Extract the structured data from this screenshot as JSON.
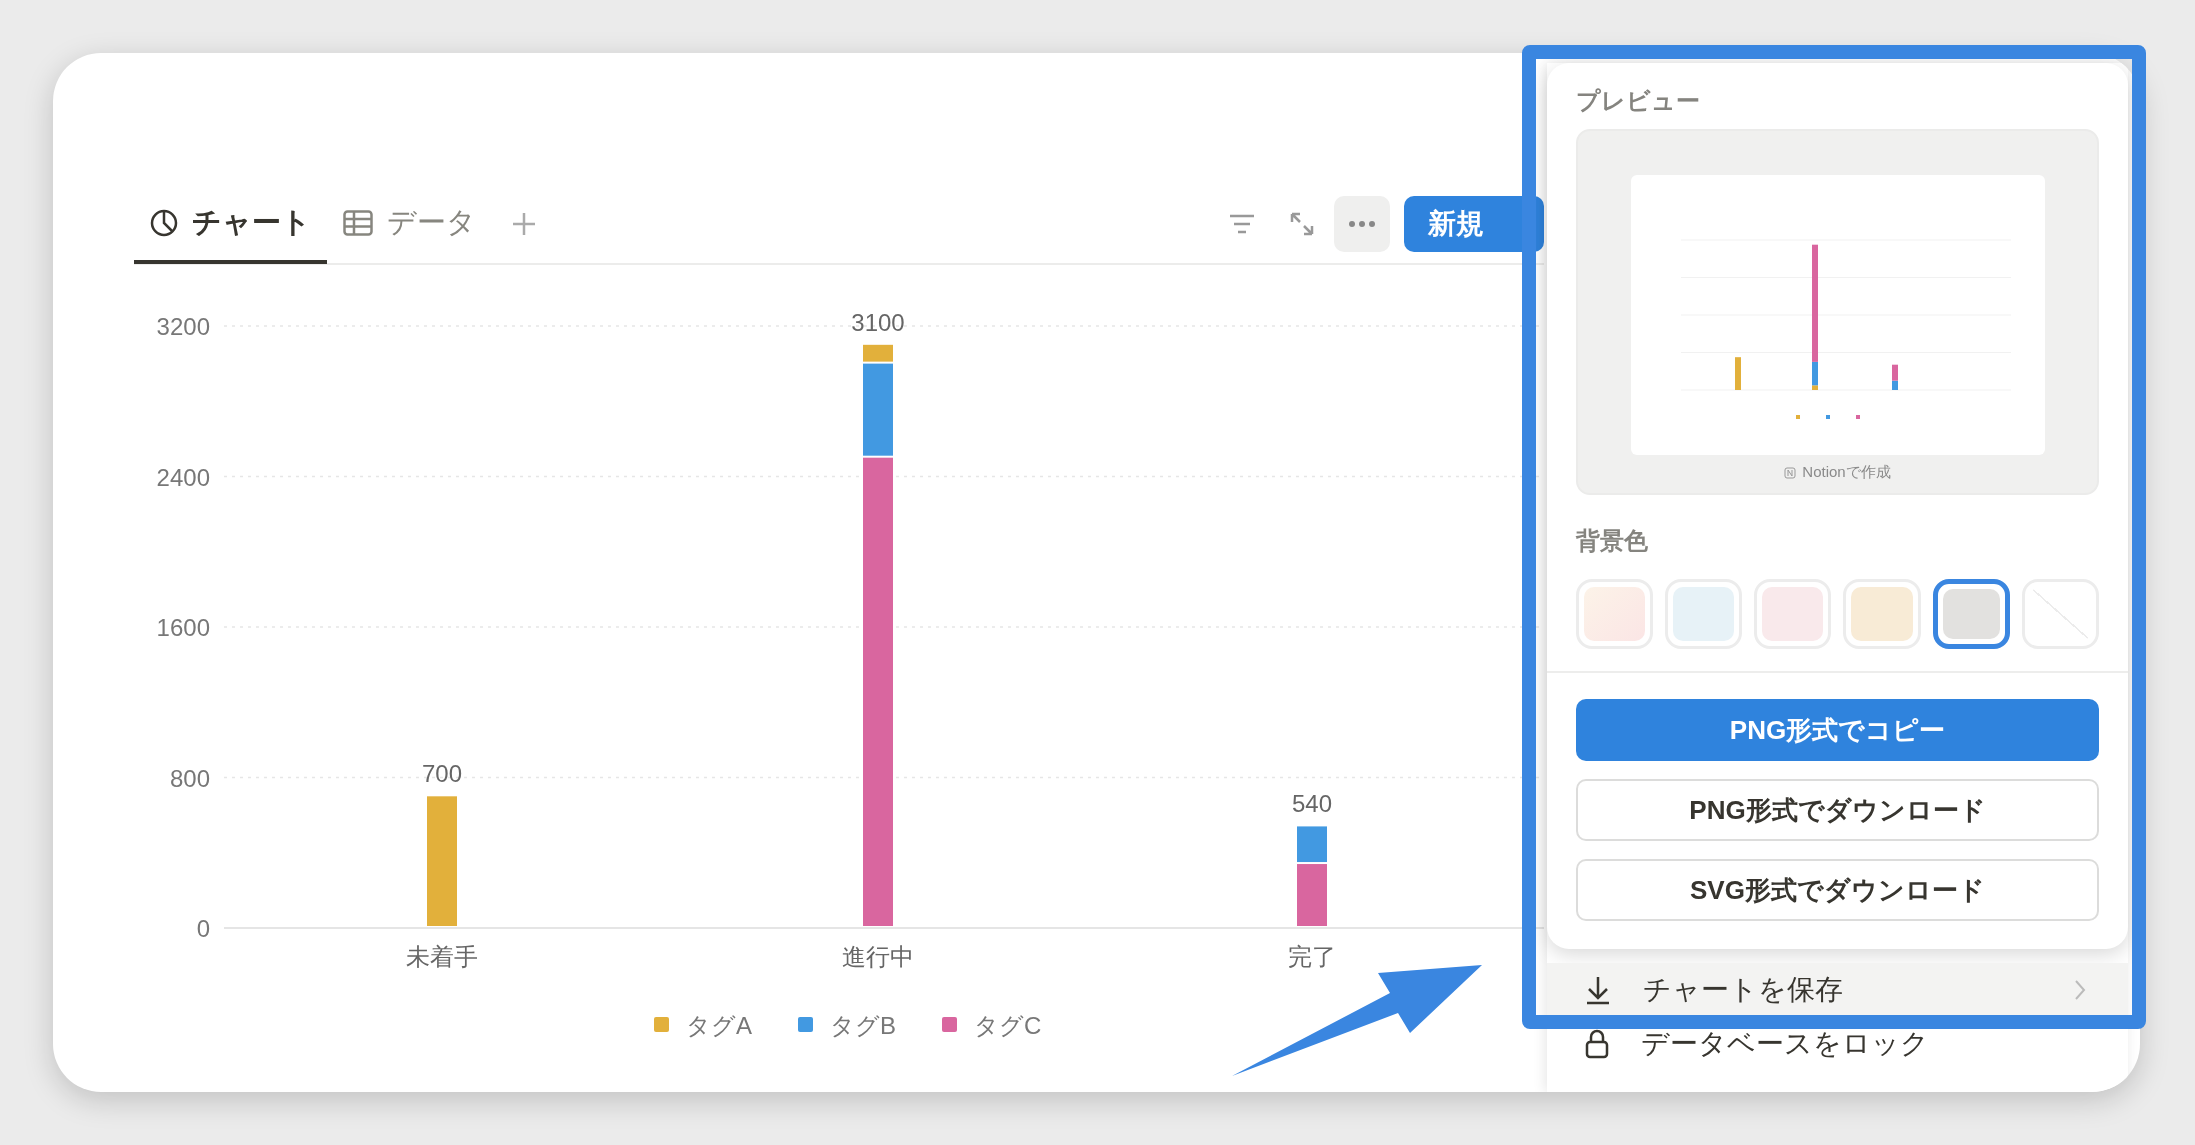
{
  "tabs": [
    {
      "label": "チャート",
      "selected": true
    },
    {
      "label": "データ",
      "selected": false
    }
  ],
  "toolbar": {
    "new_button": "新規"
  },
  "chart": {
    "chart_data": {
      "type": "bar",
      "stacked": true,
      "categories": [
        "未着手",
        "進行中",
        "完了"
      ],
      "series": [
        {
          "name": "タグA",
          "color": "#e2b03b",
          "values": [
            700,
            100,
            null
          ]
        },
        {
          "name": "タグB",
          "color": "#4299e1",
          "values": [
            null,
            500,
            200
          ]
        },
        {
          "name": "タグC",
          "color": "#d9669f",
          "values": [
            null,
            2500,
            340
          ]
        }
      ],
      "ylim": [
        0,
        3200
      ],
      "grid": true,
      "legend": true,
      "yticks": [
        0,
        800,
        1600,
        2400,
        3200
      ],
      "value_labels": [
        "700",
        "3100",
        "540"
      ]
    }
  },
  "panel": {
    "preview_label": "プレビュー",
    "preview_footer": "Notionで作成",
    "background_label": "背景色",
    "swatches": [
      {
        "kind": "gradient",
        "color": "#fcf3e8",
        "selected": false
      },
      {
        "kind": "solid",
        "color": "#e7f2f7",
        "selected": false
      },
      {
        "kind": "solid",
        "color": "#f9e9eb",
        "selected": false
      },
      {
        "kind": "solid",
        "color": "#f8ebd6",
        "selected": false
      },
      {
        "kind": "solid",
        "color": "#e2e1df",
        "selected": true
      },
      {
        "kind": "none",
        "color": "#ffffff",
        "selected": false
      }
    ],
    "buttons": [
      {
        "label": "PNG形式でコピー",
        "primary": true
      },
      {
        "label": "PNG形式でダウンロード",
        "primary": false
      },
      {
        "label": "SVG形式でダウンロード",
        "primary": false
      }
    ],
    "menu": [
      {
        "label": "チャートを保存",
        "submenu": true
      },
      {
        "label": "データベースをロック",
        "submenu": false
      }
    ]
  }
}
